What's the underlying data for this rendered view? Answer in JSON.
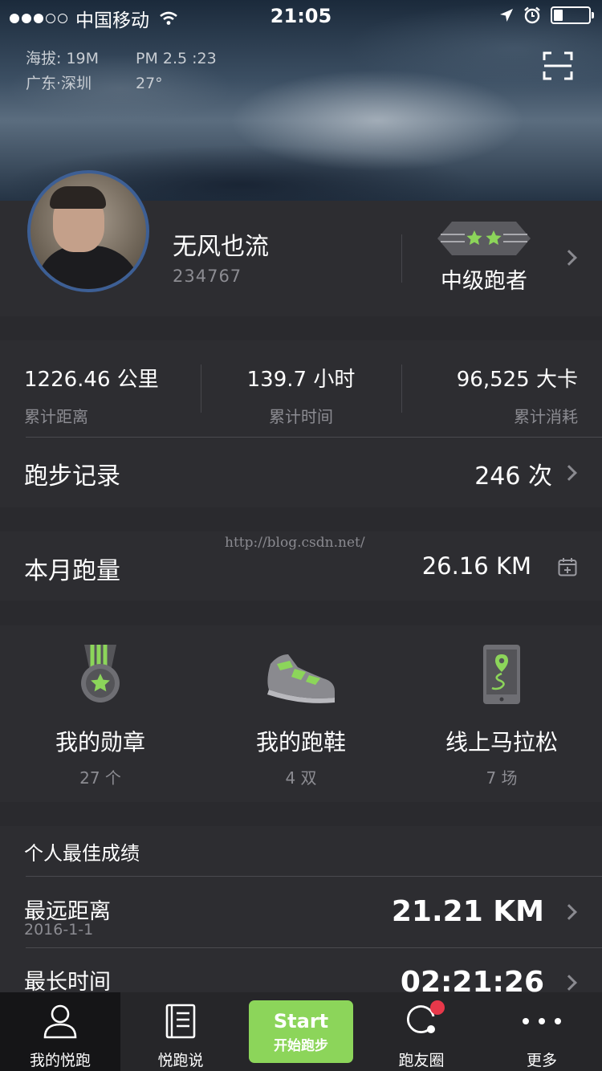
{
  "status_bar": {
    "carrier": "中国移动",
    "time": "21:05",
    "signal_bars_filled": 3,
    "signal_bars_total": 5,
    "battery_level": 0.25
  },
  "weather": {
    "altitude": "海拔: 19M",
    "pm25": "PM 2.5 :23",
    "location": "广东·深圳",
    "temperature": "27°"
  },
  "profile": {
    "nickname": "无风也流",
    "user_id": "234767",
    "rank": "中级跑者",
    "rank_stars": 2
  },
  "stats": {
    "distance": {
      "value": "1226.46 公里",
      "label": "累计距离"
    },
    "duration": {
      "value": "139.7 小时",
      "label": "累计时间"
    },
    "calories": {
      "value": "96,525 大卡",
      "label": "累计消耗"
    },
    "record_label": "跑步记录",
    "record_count": "246 次"
  },
  "month": {
    "title": "本月跑量",
    "distance": "26.16  KM",
    "watermark": "http://blog.csdn.net/"
  },
  "features": [
    {
      "name": "我的勋章",
      "count": "27 个",
      "icon": "medal-icon"
    },
    {
      "name": "我的跑鞋",
      "count": "4 双",
      "icon": "shoe-icon"
    },
    {
      "name": "线上马拉松",
      "count": "7 场",
      "icon": "phone-map-icon"
    }
  ],
  "best": {
    "header": "个人最佳成绩",
    "rows": [
      {
        "label": "最远距离",
        "date": "2016-1-1",
        "value": "21.21 KM"
      },
      {
        "label": "最长时间",
        "date": "",
        "value": "02:21:26"
      }
    ]
  },
  "tabbar": {
    "tabs": [
      "我的悦跑",
      "悦跑说",
      "跑友圈",
      "更多"
    ],
    "start_main": "Start",
    "start_sub": "开始跑步"
  },
  "colors": {
    "accent_green": "#8cd55a",
    "badge_red": "#e8384a",
    "avatar_ring": "#3d5f95",
    "card_bg": "#2d2d31",
    "page_bg": "#2a2a2e"
  }
}
